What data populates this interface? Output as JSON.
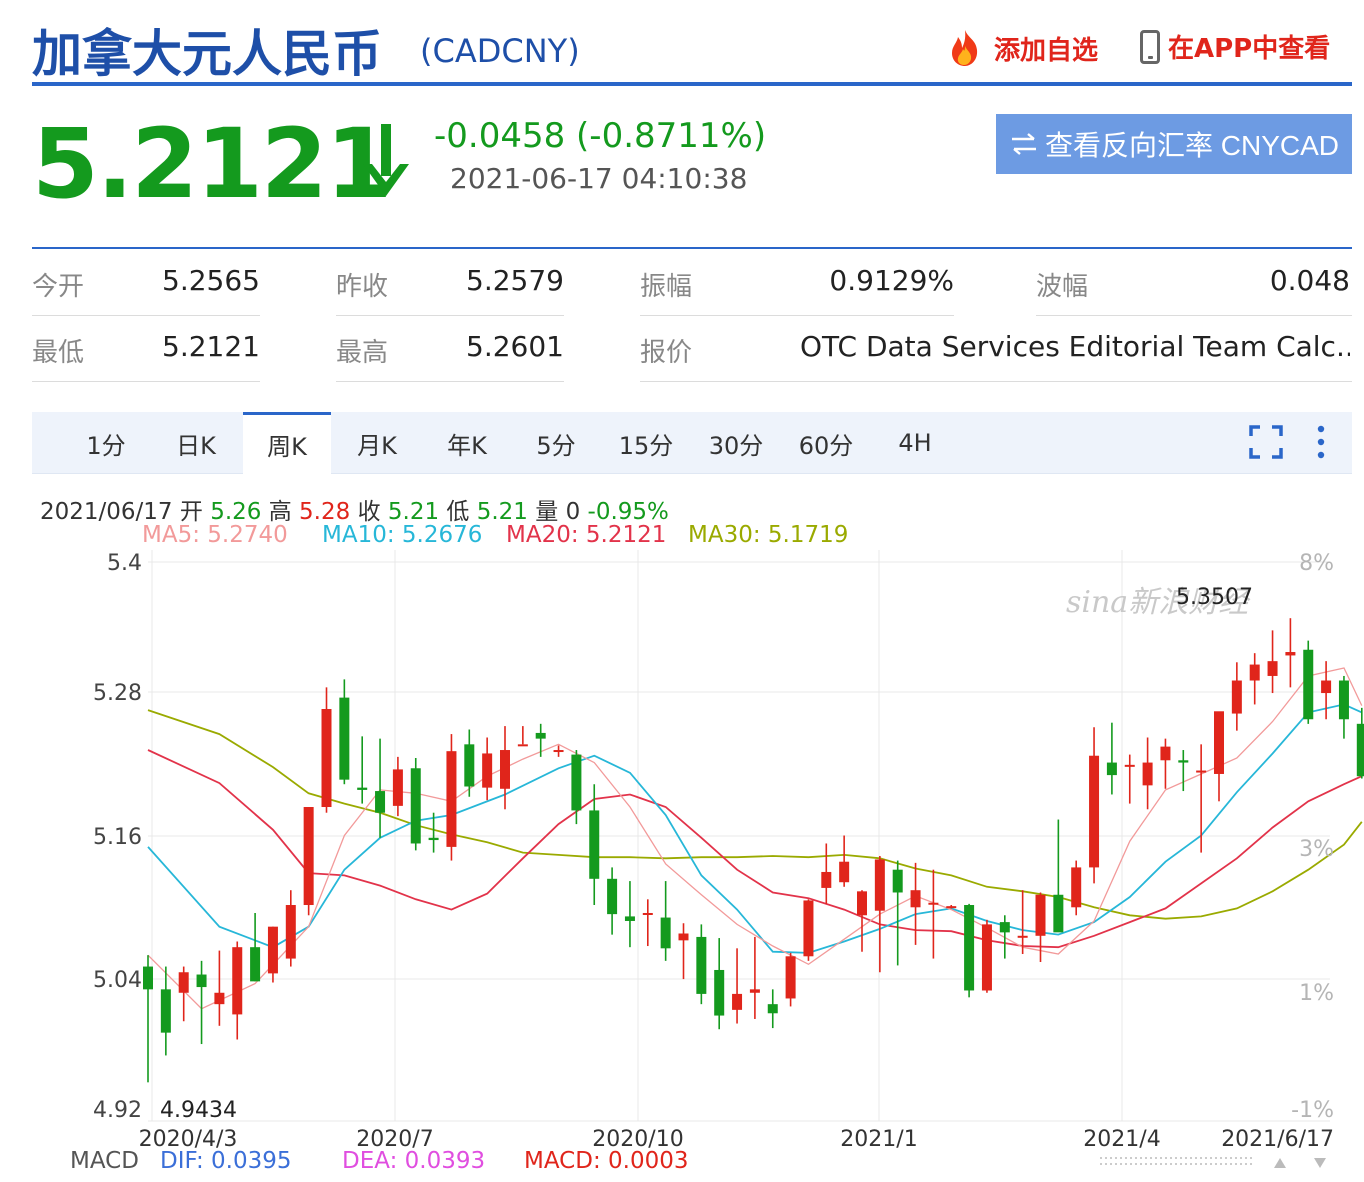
{
  "header": {
    "title": "加拿大元人民币",
    "code": "(CADCNY)",
    "add_watchlist": "添加自选",
    "view_in_app": "在APP中查看"
  },
  "quote": {
    "price": "5.2121",
    "change": "-0.0458 (-0.8711%)",
    "time": "2021-06-17 04:10:38",
    "reverse_button": "查看反向汇率 CNYCAD",
    "reverse_icon": "swap-arrows-icon",
    "down_color": "#149a1e",
    "up_color": "#e0251b"
  },
  "stats": {
    "open_label": "今开",
    "open": "5.2565",
    "prev_close_label": "昨收",
    "prev_close": "5.2579",
    "amplitude_label": "振幅",
    "amplitude": "0.9129%",
    "range_label": "波幅",
    "range": "0.048",
    "low_label": "最低",
    "low": "5.2121",
    "high_label": "最高",
    "high": "5.2601",
    "source_label": "报价",
    "source": "OTC Data Services Editorial Team Calc..."
  },
  "tabs": [
    "1分",
    "日K",
    "周K",
    "月K",
    "年K",
    "5分",
    "15分",
    "30分",
    "60分",
    "4H"
  ],
  "active_tab": "周K",
  "bar_info": {
    "date": "2021/06/17",
    "open_label": "开",
    "open": "5.26",
    "high_label": "高",
    "high": "5.28",
    "close_label": "收",
    "close": "5.21",
    "low_label": "低",
    "low": "5.21",
    "vol_label": "量",
    "vol": "0",
    "pct": "-0.95%"
  },
  "ma": {
    "ma5": "MA5: 5.2740",
    "ma10": "MA10: 5.2676",
    "ma20": "MA20: 5.2121",
    "ma30": "MA30: 5.1719",
    "ma5_color": "#f29a9a",
    "ma10_color": "#27b7d8",
    "ma20_color": "#e2334a",
    "ma30_color": "#9aaa00"
  },
  "macd": {
    "label": "MACD",
    "dif": "DIF: 0.0395",
    "dea": "DEA: 0.0393",
    "macd": "MACD: 0.0003",
    "dif_color": "#3b6fd8",
    "dea_color": "#e04ee0",
    "macd_color": "#e0251b"
  },
  "watermark": "sina新浪财经",
  "chart_data": {
    "type": "candlestick",
    "period": "weekly",
    "y_ticks": [
      "5.4",
      "5.28",
      "5.16",
      "5.04",
      "4.92"
    ],
    "y_right_ticks": [
      "8%",
      "3%",
      "1%",
      "-1%"
    ],
    "x_ticks": [
      "2020/4/3",
      "2020/7",
      "2020/10",
      "2021/1",
      "2021/4",
      "2021/6/17"
    ],
    "ylim": [
      4.92,
      5.4
    ],
    "max_label": "5.3507",
    "min_label": "4.9434",
    "candles": [
      {
        "o": 5.045,
        "h": 5.055,
        "l": 4.9434,
        "c": 5.025
      },
      {
        "o": 5.025,
        "h": 5.045,
        "l": 4.967,
        "c": 4.987
      },
      {
        "o": 5.022,
        "h": 5.045,
        "l": 4.997,
        "c": 5.04
      },
      {
        "o": 5.038,
        "h": 5.05,
        "l": 4.977,
        "c": 5.027
      },
      {
        "o": 5.012,
        "h": 5.059,
        "l": 4.993,
        "c": 5.022
      },
      {
        "o": 5.003,
        "h": 5.067,
        "l": 4.981,
        "c": 5.062
      },
      {
        "o": 5.062,
        "h": 5.092,
        "l": 5.032,
        "c": 5.032
      },
      {
        "o": 5.039,
        "h": 5.08,
        "l": 5.031,
        "c": 5.08
      },
      {
        "o": 5.052,
        "h": 5.112,
        "l": 5.045,
        "c": 5.099
      },
      {
        "o": 5.099,
        "h": 5.185,
        "l": 5.09,
        "c": 5.185
      },
      {
        "o": 5.185,
        "h": 5.29,
        "l": 5.18,
        "c": 5.271
      },
      {
        "o": 5.281,
        "h": 5.297,
        "l": 5.205,
        "c": 5.209
      },
      {
        "o": 5.202,
        "h": 5.247,
        "l": 5.188,
        "c": 5.2
      },
      {
        "o": 5.199,
        "h": 5.245,
        "l": 5.158,
        "c": 5.18
      },
      {
        "o": 5.186,
        "h": 5.229,
        "l": 5.177,
        "c": 5.218
      },
      {
        "o": 5.219,
        "h": 5.228,
        "l": 5.147,
        "c": 5.153
      },
      {
        "o": 5.158,
        "h": 5.18,
        "l": 5.145,
        "c": 5.156
      },
      {
        "o": 5.15,
        "h": 5.249,
        "l": 5.138,
        "c": 5.234
      },
      {
        "o": 5.24,
        "h": 5.253,
        "l": 5.194,
        "c": 5.203
      },
      {
        "o": 5.202,
        "h": 5.246,
        "l": 5.191,
        "c": 5.232
      },
      {
        "o": 5.201,
        "h": 5.256,
        "l": 5.183,
        "c": 5.235
      },
      {
        "o": 5.24,
        "h": 5.256,
        "l": 5.24,
        "c": 5.24
      },
      {
        "o": 5.25,
        "h": 5.258,
        "l": 5.229,
        "c": 5.245
      },
      {
        "o": 5.235,
        "h": 5.239,
        "l": 5.229,
        "c": 5.235
      },
      {
        "o": 5.231,
        "h": 5.235,
        "l": 5.17,
        "c": 5.182
      },
      {
        "o": 5.182,
        "h": 5.205,
        "l": 5.099,
        "c": 5.122
      },
      {
        "o": 5.122,
        "h": 5.132,
        "l": 5.073,
        "c": 5.091
      },
      {
        "o": 5.089,
        "h": 5.12,
        "l": 5.062,
        "c": 5.085
      },
      {
        "o": 5.091,
        "h": 5.104,
        "l": 5.063,
        "c": 5.092
      },
      {
        "o": 5.088,
        "h": 5.12,
        "l": 5.05,
        "c": 5.061
      },
      {
        "o": 5.068,
        "h": 5.083,
        "l": 5.034,
        "c": 5.074
      },
      {
        "o": 5.071,
        "h": 5.082,
        "l": 5.012,
        "c": 5.021
      },
      {
        "o": 5.042,
        "h": 5.07,
        "l": 4.99,
        "c": 5.002
      },
      {
        "o": 5.007,
        "h": 5.061,
        "l": 4.995,
        "c": 5.021
      },
      {
        "o": 5.022,
        "h": 5.071,
        "l": 4.999,
        "c": 5.025
      },
      {
        "o": 5.012,
        "h": 5.025,
        "l": 4.991,
        "c": 5.004
      },
      {
        "o": 5.017,
        "h": 5.057,
        "l": 5.01,
        "c": 5.054
      },
      {
        "o": 5.054,
        "h": 5.104,
        "l": 5.05,
        "c": 5.103
      },
      {
        "o": 5.114,
        "h": 5.153,
        "l": 5.1,
        "c": 5.128
      },
      {
        "o": 5.119,
        "h": 5.16,
        "l": 5.115,
        "c": 5.137
      },
      {
        "o": 5.09,
        "h": 5.112,
        "l": 5.058,
        "c": 5.111
      },
      {
        "o": 5.094,
        "h": 5.142,
        "l": 5.04,
        "c": 5.139
      },
      {
        "o": 5.13,
        "h": 5.138,
        "l": 5.046,
        "c": 5.11
      },
      {
        "o": 5.097,
        "h": 5.136,
        "l": 5.064,
        "c": 5.112
      },
      {
        "o": 5.101,
        "h": 5.13,
        "l": 5.052,
        "c": 5.101
      },
      {
        "o": 5.098,
        "h": 5.099,
        "l": 5.096,
        "c": 5.098
      },
      {
        "o": 5.099,
        "h": 5.1,
        "l": 5.018,
        "c": 5.024
      },
      {
        "o": 5.024,
        "h": 5.086,
        "l": 5.022,
        "c": 5.082
      },
      {
        "o": 5.084,
        "h": 5.09,
        "l": 5.052,
        "c": 5.075
      },
      {
        "o": 5.072,
        "h": 5.112,
        "l": 5.056,
        "c": 5.072
      },
      {
        "o": 5.072,
        "h": 5.11,
        "l": 5.049,
        "c": 5.108
      },
      {
        "o": 5.108,
        "h": 5.174,
        "l": 5.082,
        "c": 5.075
      },
      {
        "o": 5.097,
        "h": 5.138,
        "l": 5.09,
        "c": 5.132
      },
      {
        "o": 5.132,
        "h": 5.255,
        "l": 5.118,
        "c": 5.23
      },
      {
        "o": 5.224,
        "h": 5.259,
        "l": 5.196,
        "c": 5.213
      },
      {
        "o": 5.222,
        "h": 5.231,
        "l": 5.188,
        "c": 5.222
      },
      {
        "o": 5.204,
        "h": 5.246,
        "l": 5.183,
        "c": 5.224
      },
      {
        "o": 5.226,
        "h": 5.245,
        "l": 5.201,
        "c": 5.238
      },
      {
        "o": 5.226,
        "h": 5.235,
        "l": 5.199,
        "c": 5.224
      },
      {
        "o": 5.217,
        "h": 5.24,
        "l": 5.145,
        "c": 5.217
      },
      {
        "o": 5.214,
        "h": 5.266,
        "l": 5.19,
        "c": 5.269
      },
      {
        "o": 5.267,
        "h": 5.312,
        "l": 5.252,
        "c": 5.296
      },
      {
        "o": 5.296,
        "h": 5.32,
        "l": 5.275,
        "c": 5.31
      },
      {
        "o": 5.3,
        "h": 5.34,
        "l": 5.285,
        "c": 5.313
      },
      {
        "o": 5.318,
        "h": 5.3507,
        "l": 5.29,
        "c": 5.321
      },
      {
        "o": 5.323,
        "h": 5.331,
        "l": 5.258,
        "c": 5.262
      },
      {
        "o": 5.285,
        "h": 5.313,
        "l": 5.262,
        "c": 5.296
      },
      {
        "o": 5.296,
        "h": 5.3,
        "l": 5.245,
        "c": 5.262
      },
      {
        "o": 5.258,
        "h": 5.272,
        "l": 5.21,
        "c": 5.212
      }
    ],
    "ma5": [
      [
        0,
        5.055
      ],
      [
        3,
        5.008
      ],
      [
        6,
        5.03
      ],
      [
        9,
        5.08
      ],
      [
        11,
        5.16
      ],
      [
        13,
        5.2
      ],
      [
        15,
        5.197
      ],
      [
        17,
        5.19
      ],
      [
        19,
        5.212
      ],
      [
        21,
        5.227
      ],
      [
        23,
        5.24
      ],
      [
        25,
        5.224
      ],
      [
        27,
        5.185
      ],
      [
        29,
        5.135
      ],
      [
        31,
        5.108
      ],
      [
        33,
        5.082
      ],
      [
        35,
        5.063
      ],
      [
        37,
        5.047
      ],
      [
        39,
        5.069
      ],
      [
        41,
        5.091
      ],
      [
        43,
        5.107
      ],
      [
        45,
        5.095
      ],
      [
        47,
        5.079
      ],
      [
        49,
        5.062
      ],
      [
        51,
        5.056
      ],
      [
        53,
        5.085
      ],
      [
        55,
        5.155
      ],
      [
        57,
        5.2
      ],
      [
        59,
        5.214
      ],
      [
        61,
        5.228
      ],
      [
        63,
        5.26
      ],
      [
        65,
        5.3
      ],
      [
        67,
        5.307
      ],
      [
        68,
        5.274
      ]
    ],
    "ma10": [
      [
        0,
        5.15
      ],
      [
        4,
        5.08
      ],
      [
        7,
        5.062
      ],
      [
        9,
        5.08
      ],
      [
        11,
        5.13
      ],
      [
        13,
        5.158
      ],
      [
        15,
        5.173
      ],
      [
        17,
        5.178
      ],
      [
        20,
        5.196
      ],
      [
        23,
        5.219
      ],
      [
        25,
        5.23
      ],
      [
        27,
        5.215
      ],
      [
        29,
        5.178
      ],
      [
        31,
        5.125
      ],
      [
        33,
        5.095
      ],
      [
        35,
        5.058
      ],
      [
        37,
        5.057
      ],
      [
        39,
        5.067
      ],
      [
        41,
        5.078
      ],
      [
        43,
        5.091
      ],
      [
        45,
        5.096
      ],
      [
        47,
        5.085
      ],
      [
        49,
        5.077
      ],
      [
        51,
        5.073
      ],
      [
        53,
        5.084
      ],
      [
        55,
        5.106
      ],
      [
        57,
        5.137
      ],
      [
        59,
        5.16
      ],
      [
        61,
        5.198
      ],
      [
        63,
        5.232
      ],
      [
        65,
        5.268
      ],
      [
        67,
        5.275
      ],
      [
        68,
        5.268
      ]
    ],
    "ma20": [
      [
        0,
        5.235
      ],
      [
        4,
        5.206
      ],
      [
        7,
        5.165
      ],
      [
        9,
        5.127
      ],
      [
        11,
        5.125
      ],
      [
        13,
        5.116
      ],
      [
        15,
        5.104
      ],
      [
        17,
        5.095
      ],
      [
        19,
        5.109
      ],
      [
        21,
        5.14
      ],
      [
        23,
        5.17
      ],
      [
        25,
        5.192
      ],
      [
        27,
        5.196
      ],
      [
        29,
        5.185
      ],
      [
        31,
        5.158
      ],
      [
        33,
        5.13
      ],
      [
        35,
        5.11
      ],
      [
        37,
        5.105
      ],
      [
        39,
        5.095
      ],
      [
        41,
        5.082
      ],
      [
        43,
        5.077
      ],
      [
        45,
        5.076
      ],
      [
        47,
        5.068
      ],
      [
        49,
        5.063
      ],
      [
        51,
        5.062
      ],
      [
        53,
        5.072
      ],
      [
        55,
        5.084
      ],
      [
        57,
        5.096
      ],
      [
        59,
        5.118
      ],
      [
        61,
        5.14
      ],
      [
        63,
        5.167
      ],
      [
        65,
        5.19
      ],
      [
        67,
        5.205
      ],
      [
        68,
        5.212
      ]
    ],
    "ma30": [
      [
        0,
        5.27
      ],
      [
        4,
        5.249
      ],
      [
        7,
        5.22
      ],
      [
        9,
        5.197
      ],
      [
        11,
        5.188
      ],
      [
        13,
        5.18
      ],
      [
        15,
        5.169
      ],
      [
        17,
        5.161
      ],
      [
        19,
        5.154
      ],
      [
        21,
        5.145
      ],
      [
        23,
        5.143
      ],
      [
        25,
        5.141
      ],
      [
        27,
        5.141
      ],
      [
        29,
        5.14
      ],
      [
        31,
        5.141
      ],
      [
        33,
        5.141
      ],
      [
        35,
        5.142
      ],
      [
        37,
        5.141
      ],
      [
        39,
        5.143
      ],
      [
        41,
        5.14
      ],
      [
        43,
        5.131
      ],
      [
        45,
        5.125
      ],
      [
        47,
        5.115
      ],
      [
        49,
        5.111
      ],
      [
        51,
        5.106
      ],
      [
        53,
        5.097
      ],
      [
        55,
        5.09
      ],
      [
        57,
        5.087
      ],
      [
        59,
        5.089
      ],
      [
        61,
        5.096
      ],
      [
        63,
        5.111
      ],
      [
        65,
        5.13
      ],
      [
        67,
        5.152
      ],
      [
        68,
        5.172
      ]
    ]
  }
}
